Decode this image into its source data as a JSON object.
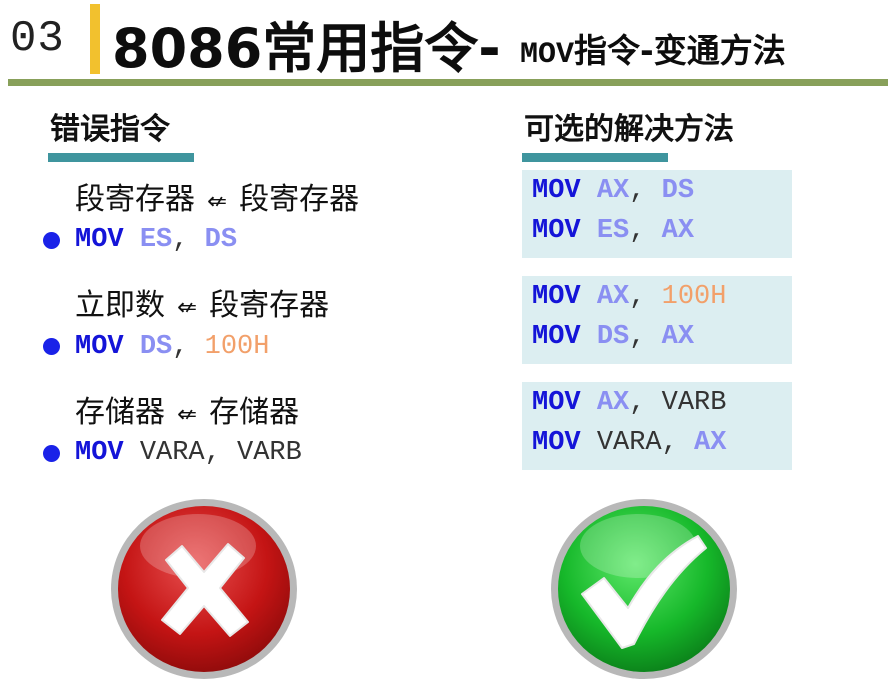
{
  "header": {
    "section_number": "03",
    "title": "8086常用指令",
    "separator": "-",
    "subtitle_code": "MOV",
    "subtitle_text": "指令-变通方法"
  },
  "left": {
    "heading": "错误指令",
    "items": [
      {
        "desc_a": "段寄存器",
        "relation": "⇍",
        "desc_b": "段寄存器",
        "op": "MOV",
        "arg1": "ES",
        "comma": ",",
        "arg2": "DS"
      },
      {
        "desc_a": "立即数",
        "relation": "⇍",
        "desc_b": "段寄存器",
        "op": "MOV",
        "arg1": "DS",
        "comma": ",",
        "arg2": "100H"
      },
      {
        "desc_a": "存储器",
        "relation": "⇍",
        "desc_b": "存储器",
        "op": "MOV",
        "arg1": "VARA",
        "comma": ",",
        "arg2": "VARB"
      }
    ]
  },
  "right": {
    "heading": "可选的解决方法",
    "boxes": [
      {
        "lines": [
          {
            "op": "MOV",
            "arg1": "AX",
            "comma": ",",
            "arg2": "DS"
          },
          {
            "op": "MOV",
            "arg1": "ES",
            "comma": ",",
            "arg2": "AX"
          }
        ]
      },
      {
        "lines": [
          {
            "op": "MOV",
            "arg1": "AX",
            "comma": ",",
            "arg2": "100H"
          },
          {
            "op": "MOV",
            "arg1": "DS",
            "comma": ",",
            "arg2": "AX"
          }
        ]
      },
      {
        "lines": [
          {
            "op": "MOV",
            "arg1": "AX",
            "comma": ",",
            "arg2": "VARB"
          },
          {
            "op": "MOV",
            "arg1": "VARA",
            "comma": ",",
            "arg2": "AX"
          }
        ]
      }
    ]
  },
  "icons": {
    "wrong": "red-cross-icon",
    "right": "green-check-icon"
  },
  "colors": {
    "accent_yellow": "#f2c12e",
    "header_rule": "#88a05a",
    "heading_underline": "#3f959e",
    "keyword": "#1414d8",
    "register": "#8a8ff2",
    "immediate": "#f2a06a",
    "box_bg": "#dceef1",
    "bullet": "#1a22e8"
  }
}
